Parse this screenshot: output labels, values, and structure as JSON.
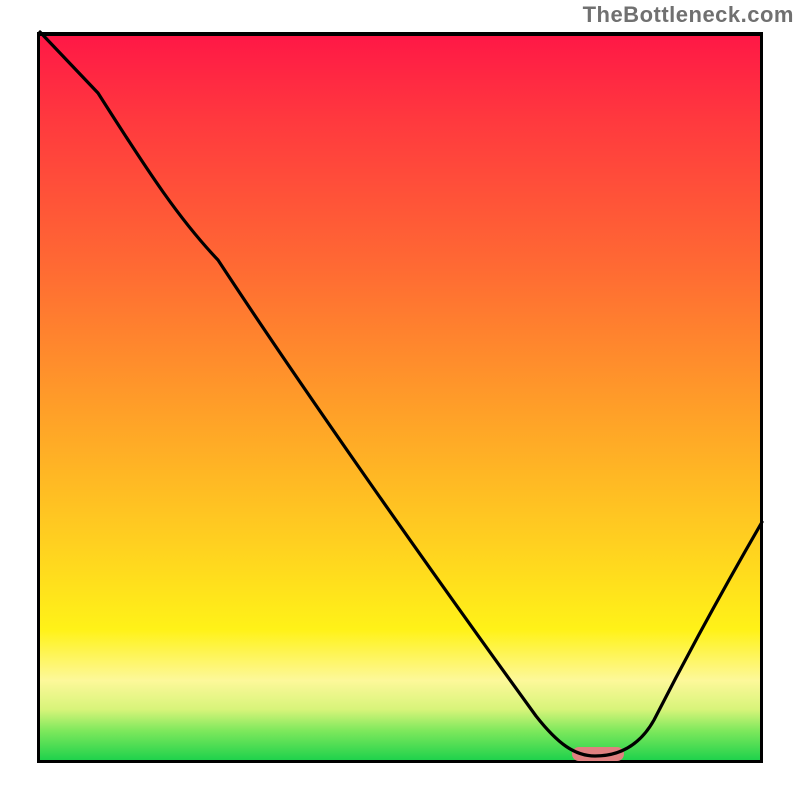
{
  "watermark": "TheBottleneck.com",
  "colors": {
    "curve": "#000000",
    "marker": "#e08080",
    "border": "#000000",
    "gradient_top": "#ff1846",
    "gradient_bottom": "#1fd24c"
  },
  "chart_data": {
    "type": "line",
    "title": "",
    "xlabel": "",
    "ylabel": "",
    "xlim": [
      0,
      100
    ],
    "ylim": [
      0,
      100
    ],
    "x": [
      0,
      8,
      18,
      25,
      40,
      55,
      69,
      74,
      79,
      84,
      100
    ],
    "values": [
      100,
      92,
      79,
      71,
      49,
      28,
      6,
      1,
      0.5,
      2,
      30
    ],
    "marker_x_range": [
      74,
      81
    ],
    "marker_y": 0.7
  }
}
